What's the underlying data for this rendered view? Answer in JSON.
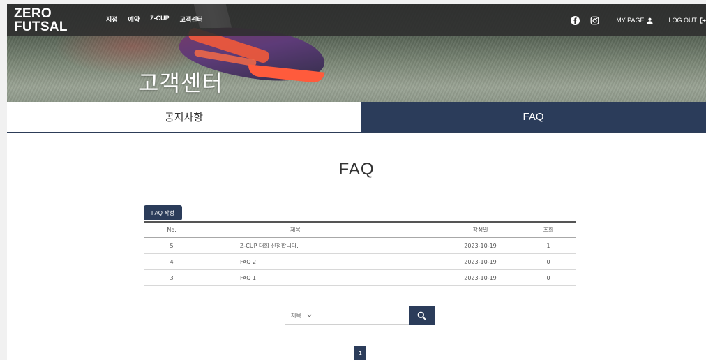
{
  "header": {
    "logo_line1": "ZERO",
    "logo_line2": "FUTSAL",
    "menu": [
      "지점",
      "예약",
      "Z-CUP",
      "고객센터"
    ],
    "my_page": "MY PAGE",
    "log_out": "LOG OUT"
  },
  "hero": {
    "title": "고객센터"
  },
  "tabs": [
    {
      "label": "공지사항",
      "active": false
    },
    {
      "label": "FAQ",
      "active": true
    }
  ],
  "section": {
    "title": "FAQ"
  },
  "toolbar": {
    "write_label": "FAQ 작성"
  },
  "table": {
    "headers": {
      "no": "No.",
      "title": "제목",
      "date": "작성일",
      "views": "조회"
    },
    "rows": [
      {
        "no": "5",
        "title": "Z-CUP 대회 신청합니다.",
        "date": "2023-10-19",
        "views": "1"
      },
      {
        "no": "4",
        "title": "FAQ 2",
        "date": "2023-10-19",
        "views": "0"
      },
      {
        "no": "3",
        "title": "FAQ 1",
        "date": "2023-10-19",
        "views": "0"
      }
    ]
  },
  "search": {
    "selected_option": "제목"
  },
  "pagination": {
    "current_page": "1"
  },
  "colors": {
    "primary": "#2b3c5a",
    "navbar": "#2d2d2d"
  }
}
